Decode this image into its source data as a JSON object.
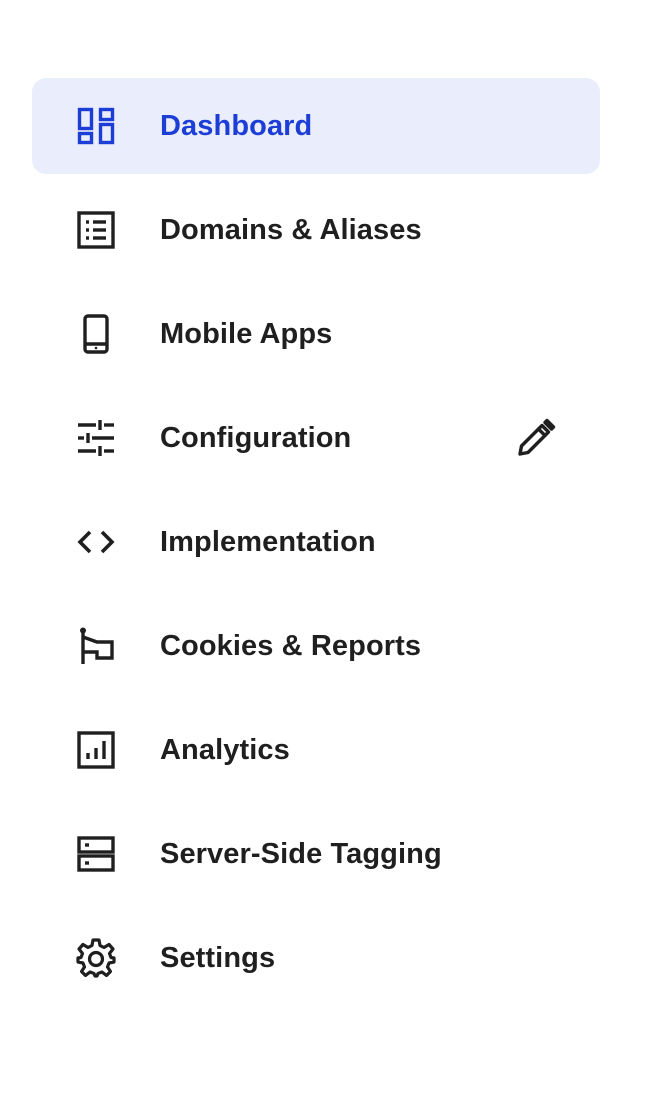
{
  "sidebar": {
    "accent_color": "#1c3ed6",
    "active_bg": "#eaeefc",
    "items": [
      {
        "label": "Dashboard",
        "icon": "dashboard-icon",
        "active": true
      },
      {
        "label": "Domains & Aliases",
        "icon": "list-icon",
        "active": false
      },
      {
        "label": "Mobile Apps",
        "icon": "phone-icon",
        "active": false
      },
      {
        "label": "Configuration",
        "icon": "sliders-icon",
        "active": false,
        "action_icon": "pencil-icon"
      },
      {
        "label": "Implementation",
        "icon": "code-icon",
        "active": false
      },
      {
        "label": "Cookies & Reports",
        "icon": "flag-icon",
        "active": false
      },
      {
        "label": "Analytics",
        "icon": "bar-chart-icon",
        "active": false
      },
      {
        "label": "Server-Side Tagging",
        "icon": "server-icon",
        "active": false
      },
      {
        "label": "Settings",
        "icon": "gear-icon",
        "active": false
      }
    ]
  }
}
